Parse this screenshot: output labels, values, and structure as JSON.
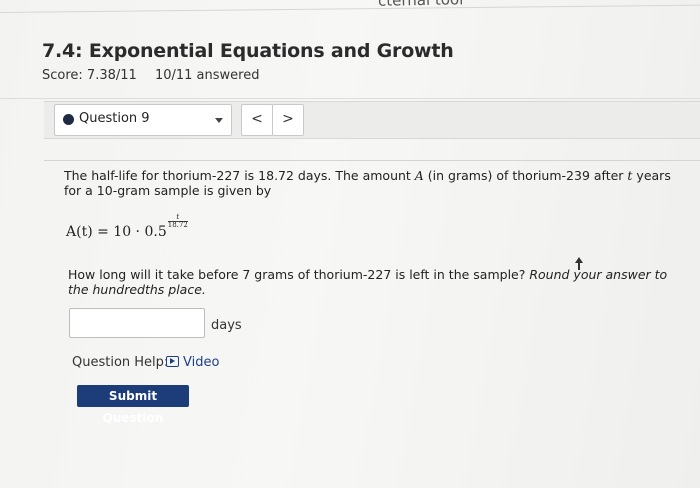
{
  "header": {
    "external_tool_fragment": "cternal tool"
  },
  "assignment": {
    "title": "7.4: Exponential Equations and Growth",
    "score": "Score: 7.38/11",
    "answered": "10/11 answered"
  },
  "question_nav": {
    "selected": "Question 9",
    "prev_symbol": "<",
    "next_symbol": ">"
  },
  "problem": {
    "text_1": "The half-life for thorium-227 is 18.72 days. The amount ",
    "var_A": "A",
    "text_2": " (in grams) of thorium-239 after ",
    "var_t": "t",
    "text_3": " years for a 10-gram sample is given by",
    "formula_lhs": "A(t) = 10 · 0.5",
    "exponent_numerator": "t",
    "exponent_denominator": "18.72",
    "question_main": "How long will it take before 7 grams of thorium-227 is left in the sample?",
    "question_round": " Round your answer to the hundredths place.",
    "answer_value": "",
    "unit": "days"
  },
  "help": {
    "label": "Question Help:",
    "video_label": "Video"
  },
  "actions": {
    "submit_label": "Submit Question"
  },
  "icons": [
    "play-icon",
    "chevron-down-icon",
    "cursor-icon"
  ],
  "colors": {
    "submit_bg": "#1d3c7a",
    "link": "#1d3f8a",
    "dot": "#1f2a44"
  }
}
